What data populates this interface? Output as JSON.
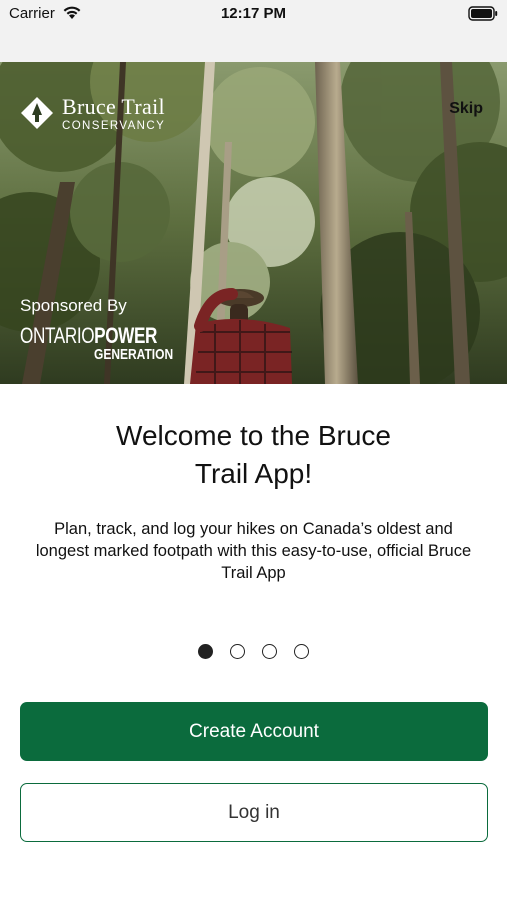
{
  "status_bar": {
    "carrier": "Carrier",
    "time": "12:17 PM",
    "wifi_icon": "wifi-icon",
    "battery_icon": "battery-full-icon"
  },
  "hero": {
    "image": "forest-hiker-photo",
    "brand": {
      "name": "Bruce Trail",
      "sub": "CONSERVANCY",
      "logo_icon": "bruce-trail-logo-icon"
    },
    "skip_label": "Skip",
    "sponsor": {
      "label": "Sponsored By",
      "logo_ontario": "ONTARIO",
      "logo_power": "POWER",
      "logo_generation": "GENERATION"
    }
  },
  "onboarding": {
    "title_line1": "Welcome to the Bruce",
    "title_line2": "Trail App!",
    "description": "Plan, track, and log your hikes on Canada’s oldest and longest marked footpath with this easy-to-use, official Bruce Trail App",
    "page_count": 4,
    "current_page": 1
  },
  "actions": {
    "create_account": "Create Account",
    "login": "Log in"
  },
  "colors": {
    "primary_green": "#0b6b3d",
    "status_bar_bg": "#f2f2f2",
    "dot_color": "#222222"
  }
}
